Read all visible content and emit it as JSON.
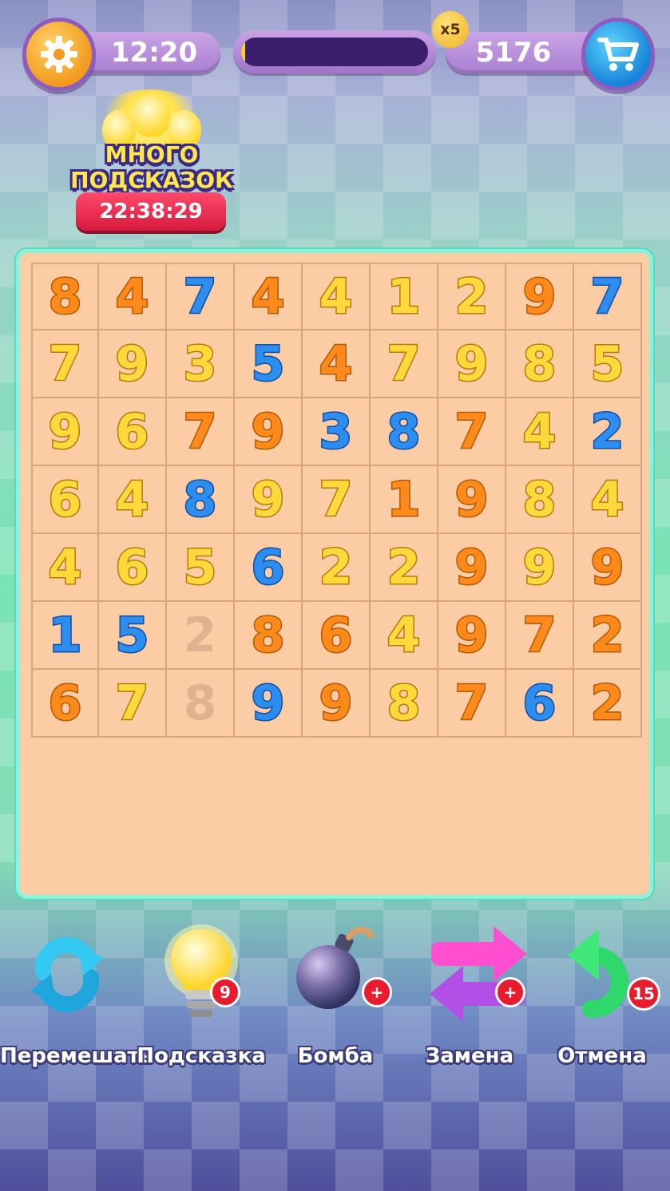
{
  "top_bar": {
    "timer": "12:20",
    "progress_fraction": 0.02,
    "multiplier": "x5",
    "coins": "5176"
  },
  "promo": {
    "title_line1": "МНОГО",
    "title_line2": "ПОДСКАЗОК",
    "countdown": "22:38:29"
  },
  "board": {
    "rows": [
      [
        {
          "v": "8",
          "c": "orange"
        },
        {
          "v": "4",
          "c": "orange"
        },
        {
          "v": "7",
          "c": "blue"
        },
        {
          "v": "4",
          "c": "orange"
        },
        {
          "v": "4",
          "c": "yellow"
        },
        {
          "v": "1",
          "c": "yellow"
        },
        {
          "v": "2",
          "c": "yellow"
        },
        {
          "v": "9",
          "c": "orange"
        },
        {
          "v": "7",
          "c": "blue"
        }
      ],
      [
        {
          "v": "7",
          "c": "yellow"
        },
        {
          "v": "9",
          "c": "yellow"
        },
        {
          "v": "3",
          "c": "yellow"
        },
        {
          "v": "5",
          "c": "blue"
        },
        {
          "v": "4",
          "c": "orange"
        },
        {
          "v": "7",
          "c": "yellow"
        },
        {
          "v": "9",
          "c": "yellow"
        },
        {
          "v": "8",
          "c": "yellow"
        },
        {
          "v": "5",
          "c": "yellow"
        }
      ],
      [
        {
          "v": "9",
          "c": "yellow"
        },
        {
          "v": "6",
          "c": "yellow"
        },
        {
          "v": "7",
          "c": "orange"
        },
        {
          "v": "9",
          "c": "orange"
        },
        {
          "v": "3",
          "c": "blue"
        },
        {
          "v": "8",
          "c": "blue"
        },
        {
          "v": "7",
          "c": "orange"
        },
        {
          "v": "4",
          "c": "yellow"
        },
        {
          "v": "2",
          "c": "blue"
        }
      ],
      [
        {
          "v": "6",
          "c": "yellow"
        },
        {
          "v": "4",
          "c": "yellow"
        },
        {
          "v": "8",
          "c": "blue"
        },
        {
          "v": "9",
          "c": "yellow"
        },
        {
          "v": "7",
          "c": "yellow"
        },
        {
          "v": "1",
          "c": "orange"
        },
        {
          "v": "9",
          "c": "orange"
        },
        {
          "v": "8",
          "c": "yellow"
        },
        {
          "v": "4",
          "c": "yellow"
        }
      ],
      [
        {
          "v": "4",
          "c": "yellow"
        },
        {
          "v": "6",
          "c": "yellow"
        },
        {
          "v": "5",
          "c": "yellow"
        },
        {
          "v": "6",
          "c": "blue"
        },
        {
          "v": "2",
          "c": "yellow"
        },
        {
          "v": "2",
          "c": "yellow"
        },
        {
          "v": "9",
          "c": "orange"
        },
        {
          "v": "9",
          "c": "yellow"
        },
        {
          "v": "9",
          "c": "orange"
        }
      ],
      [
        {
          "v": "1",
          "c": "blue"
        },
        {
          "v": "5",
          "c": "blue"
        },
        {
          "v": "2",
          "c": "faded"
        },
        {
          "v": "8",
          "c": "orange"
        },
        {
          "v": "6",
          "c": "orange"
        },
        {
          "v": "4",
          "c": "yellow"
        },
        {
          "v": "9",
          "c": "orange"
        },
        {
          "v": "7",
          "c": "orange"
        },
        {
          "v": "2",
          "c": "orange"
        }
      ],
      [
        {
          "v": "6",
          "c": "orange"
        },
        {
          "v": "7",
          "c": "yellow"
        },
        {
          "v": "8",
          "c": "faded"
        },
        {
          "v": "9",
          "c": "blue"
        },
        {
          "v": "9",
          "c": "orange"
        },
        {
          "v": "8",
          "c": "yellow"
        },
        {
          "v": "7",
          "c": "orange"
        },
        {
          "v": "6",
          "c": "blue"
        },
        {
          "v": "2",
          "c": "orange"
        }
      ]
    ]
  },
  "tools": [
    {
      "label": "Перемешать",
      "icon": "shuffle-icon",
      "badge": ""
    },
    {
      "label": "Подсказка",
      "icon": "lightbulb-icon",
      "badge": "9"
    },
    {
      "label": "Бомба",
      "icon": "bomb-icon",
      "badge": "+"
    },
    {
      "label": "Замена",
      "icon": "swap-arrows-icon",
      "badge": "+"
    },
    {
      "label": "Отмена",
      "icon": "undo-arrow-icon",
      "badge": "15"
    }
  ]
}
